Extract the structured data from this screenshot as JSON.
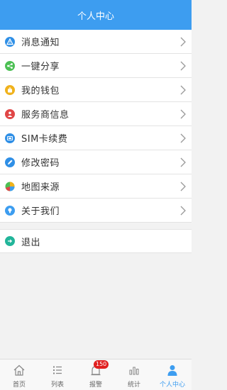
{
  "header": {
    "title": "个人中心"
  },
  "menu": [
    {
      "label": "消息通知",
      "icon": "alert-triangle-icon",
      "color": "#2f8fe6"
    },
    {
      "label": "一键分享",
      "icon": "share-icon",
      "color": "#4cc054"
    },
    {
      "label": "我的钱包",
      "icon": "wallet-icon",
      "color": "#f0b21c"
    },
    {
      "label": "服务商信息",
      "icon": "provider-icon",
      "color": "#e04646"
    },
    {
      "label": "SIM卡续费",
      "icon": "sim-card-icon",
      "color": "#2f8fe6"
    },
    {
      "label": "修改密码",
      "icon": "pencil-icon",
      "color": "#2f8fe6"
    },
    {
      "label": "地图来源",
      "icon": "map-pie-icon",
      "color": "#4cc054"
    },
    {
      "label": "关于我们",
      "icon": "lightbulb-icon",
      "color": "#3d9df0"
    }
  ],
  "logout": {
    "label": "退出",
    "icon": "logout-icon",
    "color": "#22b59a"
  },
  "tabs": [
    {
      "label": "首页",
      "icon": "home-icon"
    },
    {
      "label": "列表",
      "icon": "list-icon"
    },
    {
      "label": "报警",
      "icon": "alarm-icon",
      "badge": "150"
    },
    {
      "label": "统计",
      "icon": "stats-icon"
    },
    {
      "label": "个人中心",
      "icon": "person-icon",
      "active": true
    }
  ],
  "colors": {
    "accent": "#3d9df0",
    "badge": "#e02020"
  }
}
